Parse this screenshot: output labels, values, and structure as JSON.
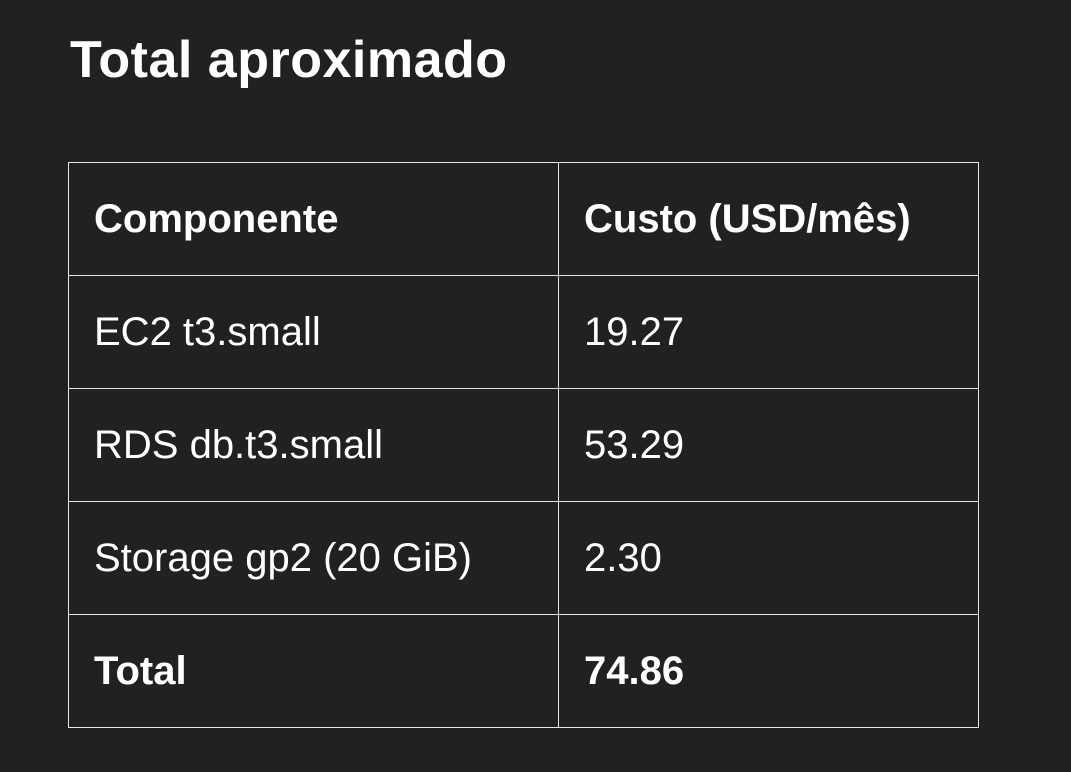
{
  "heading": "Total aproximado",
  "table": {
    "headers": [
      "Componente",
      "Custo (USD/mês)"
    ],
    "rows": [
      [
        "EC2 t3.small",
        "19.27"
      ],
      [
        "RDS db.t3.small",
        "53.29"
      ],
      [
        "Storage gp2 (20 GiB)",
        "2.30"
      ]
    ],
    "total": [
      "Total",
      "74.86"
    ]
  },
  "colors": {
    "background": "#212121",
    "text": "#ffffff",
    "border": "#e8e8e8"
  }
}
